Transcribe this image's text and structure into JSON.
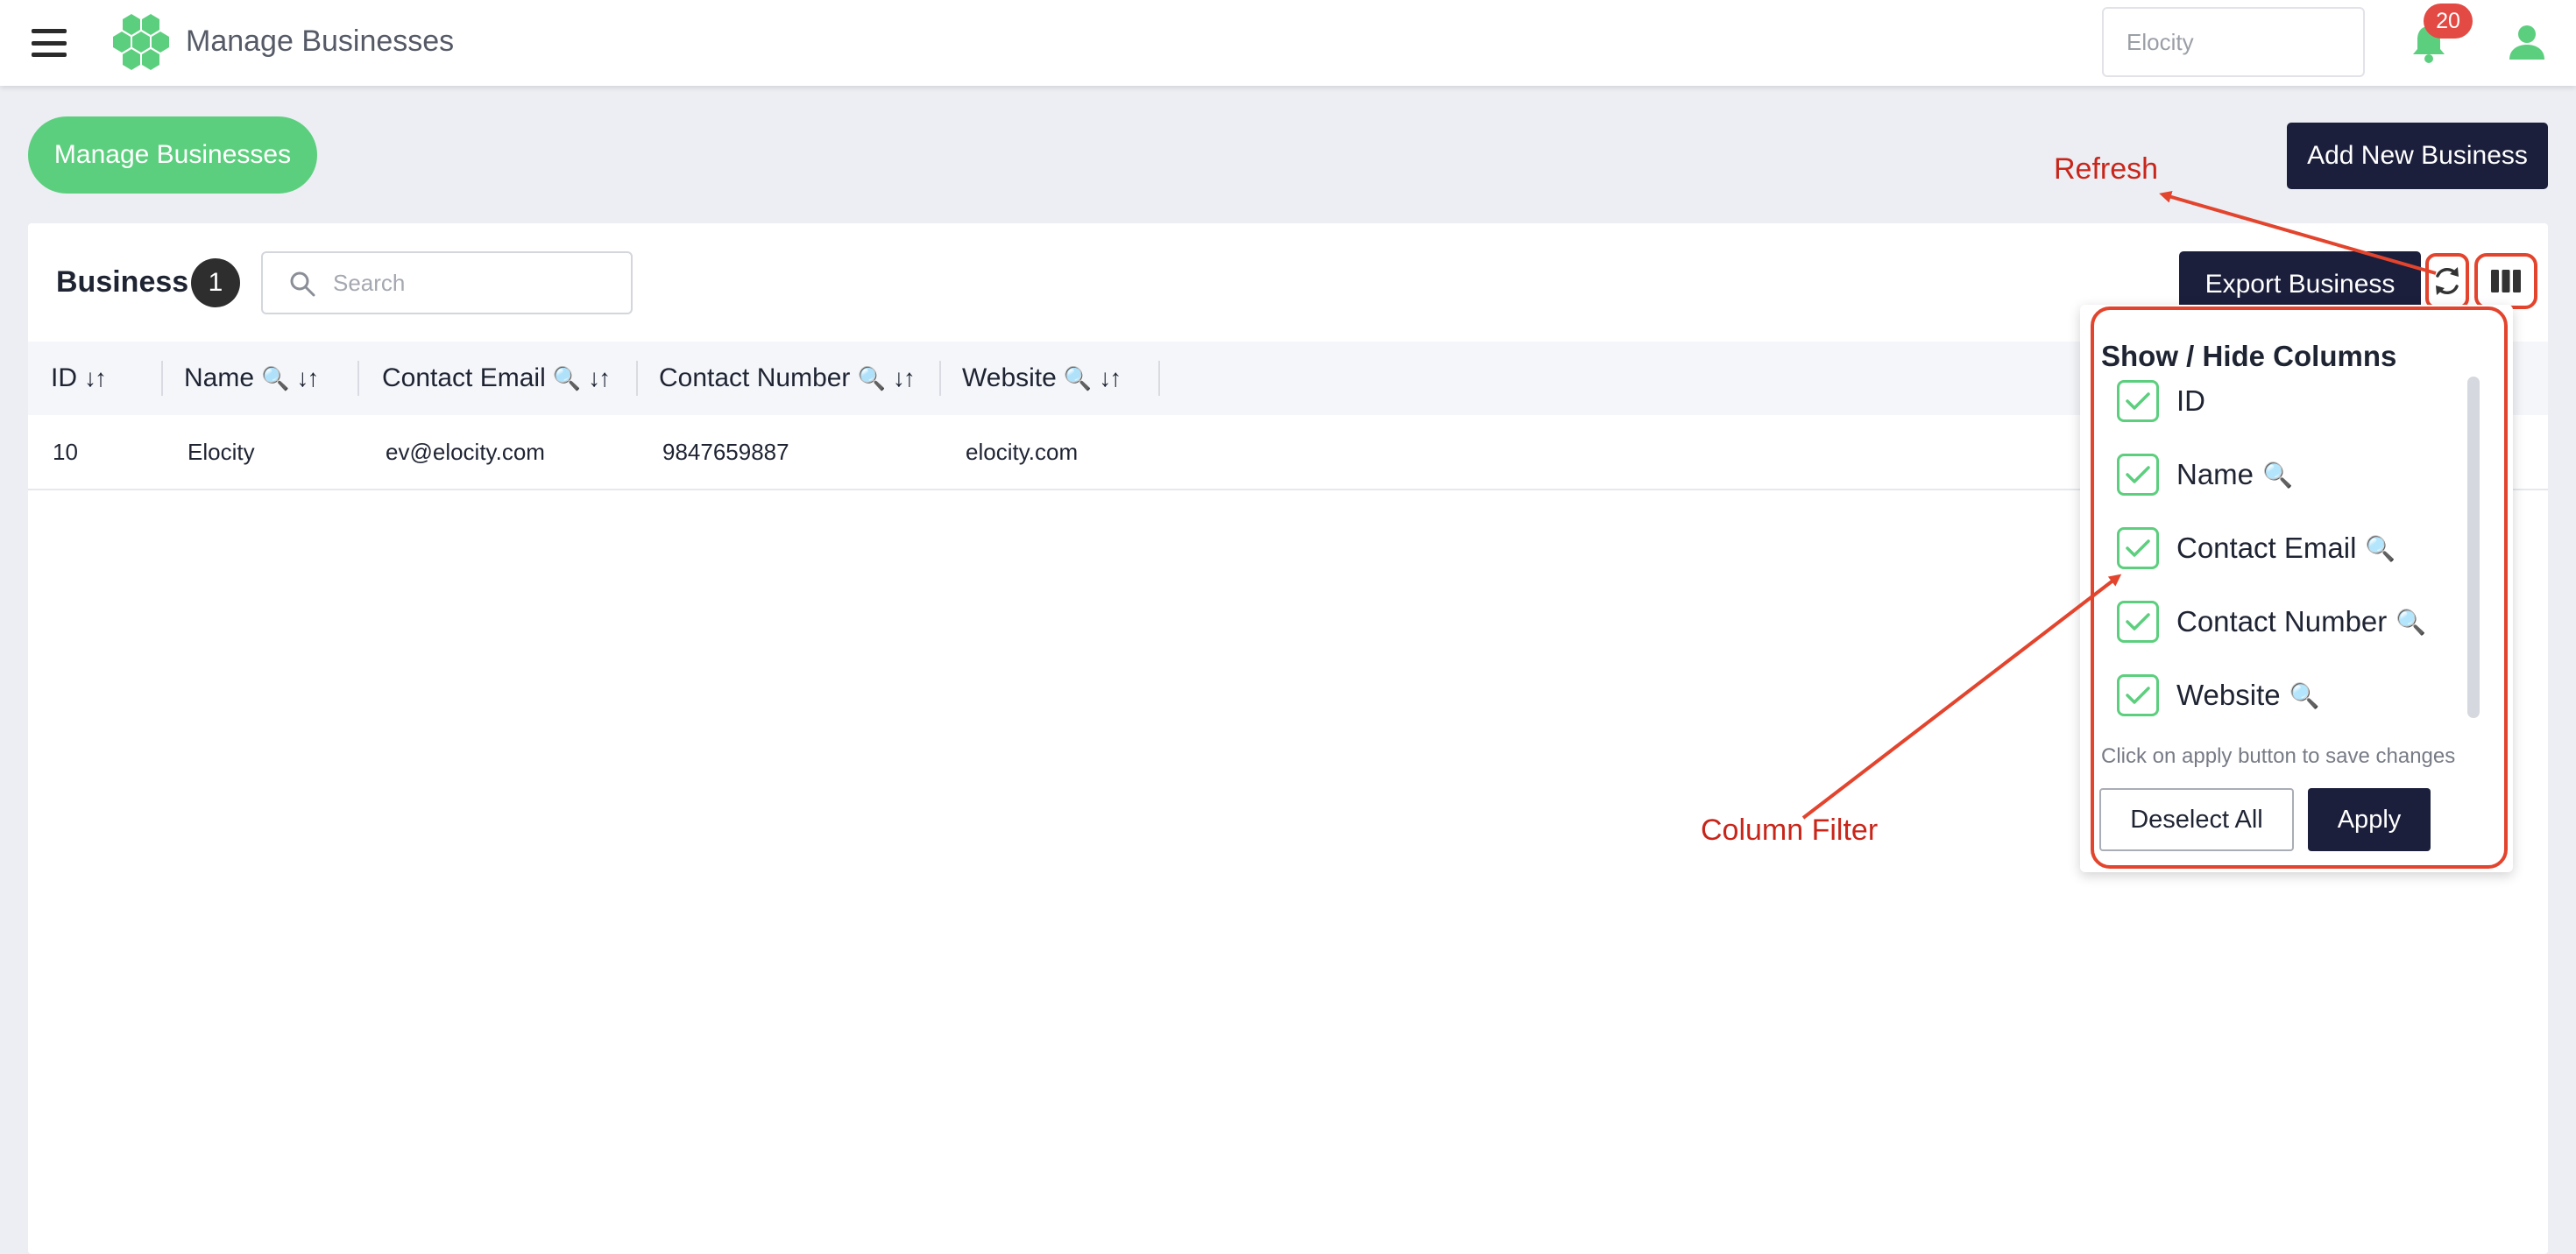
{
  "topbar": {
    "title": "Manage Businesses",
    "business_select_value": "Elocity",
    "notification_count": "20"
  },
  "page": {
    "pill_title": "Manage Businesses",
    "add_button": "Add New Business"
  },
  "card": {
    "heading": "Business",
    "count": "1",
    "search_placeholder": "Search",
    "export_button": "Export Business"
  },
  "table": {
    "columns": [
      {
        "label": "ID",
        "searchable": false
      },
      {
        "label": "Name",
        "searchable": true
      },
      {
        "label": "Contact Email",
        "searchable": true
      },
      {
        "label": "Contact Number",
        "searchable": true
      },
      {
        "label": "Website",
        "searchable": true
      }
    ],
    "rows": [
      {
        "id": "10",
        "name": "Elocity",
        "email": "ev@elocity.com",
        "phone": "9847659887",
        "website": "elocity.com"
      }
    ]
  },
  "column_filter": {
    "title": "Show / Hide Columns",
    "items": [
      {
        "label": "ID",
        "checked": true
      },
      {
        "label": "Name",
        "checked": true
      },
      {
        "label": "Contact Email",
        "checked": true
      },
      {
        "label": "Contact Number",
        "checked": true
      },
      {
        "label": "Website",
        "checked": true
      }
    ],
    "hint": "Click on apply button to save changes",
    "deselect_button": "Deselect All",
    "apply_button": "Apply"
  },
  "annotations": {
    "refresh": "Refresh",
    "column_filter": "Column Filter"
  },
  "icons": {
    "mag": "🔍",
    "sort": "↓↑"
  },
  "colors": {
    "brand_green": "#5ccf7e",
    "primary_navy": "#1b1f3b",
    "annotation_red": "#e3442d",
    "badge_red": "#e24a43"
  }
}
